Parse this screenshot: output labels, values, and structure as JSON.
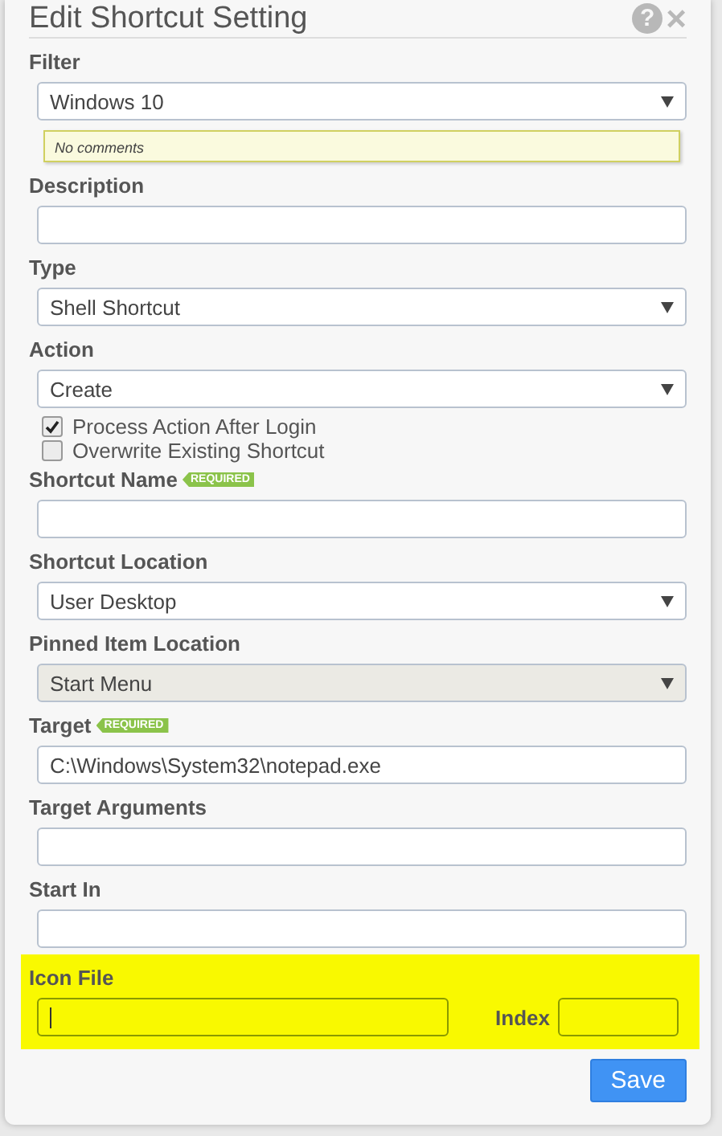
{
  "dialog": {
    "title": "Edit Shortcut Setting",
    "help_icon": "?",
    "close_icon": "×"
  },
  "fields": [
    {
      "kind": "select",
      "label": "Filter",
      "value": "Windows 10",
      "comment": "No comments"
    },
    {
      "kind": "input",
      "label": "Description"
    },
    {
      "kind": "select",
      "label": "Type",
      "value": "Shell Shortcut"
    },
    {
      "kind": "select",
      "label": "Action",
      "value": "Create"
    },
    {
      "kind": "checkbox",
      "label": "Process Action After Login",
      "checked": true
    },
    {
      "kind": "checkbox",
      "label": "Overwrite Existing Shortcut",
      "checked": false
    },
    {
      "kind": "input",
      "label": "Shortcut Name",
      "badge": "REQUIRED"
    },
    {
      "kind": "select",
      "label": "Shortcut Location",
      "value": "User Desktop"
    },
    {
      "kind": "select",
      "label": "Pinned Item Location",
      "value": "Start Menu",
      "disabled": true
    },
    {
      "kind": "input",
      "label": "Target",
      "badge": "REQUIRED",
      "value": "C:\\Windows\\System32\\notepad.exe"
    },
    {
      "kind": "input",
      "label": "Target Arguments"
    },
    {
      "kind": "input",
      "label": "Start In"
    }
  ],
  "icon_section": {
    "label": "Icon File",
    "index_label": "Index",
    "highlighted": true
  },
  "buttons": [
    {
      "label": "Save"
    }
  ]
}
